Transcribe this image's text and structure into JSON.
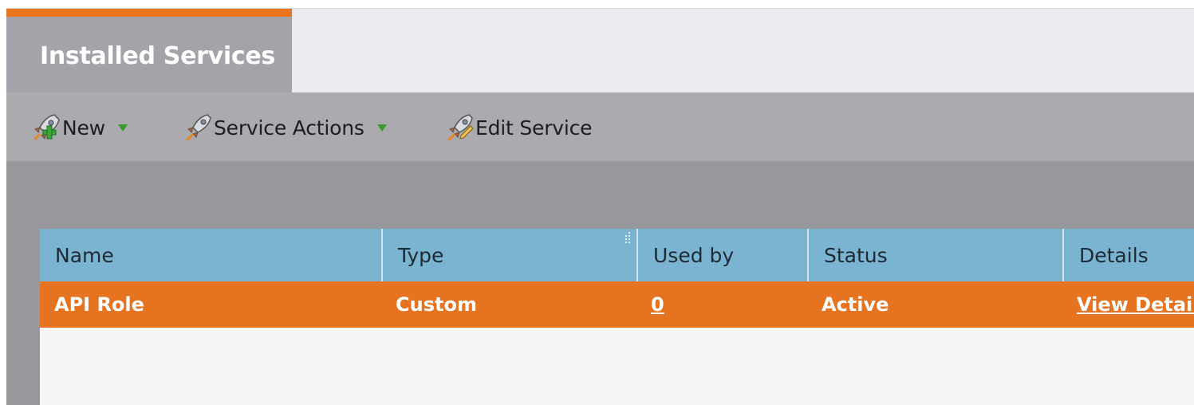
{
  "tabs": [
    {
      "label": "Installed Services",
      "active": true
    }
  ],
  "toolbar": {
    "new_label": "New",
    "service_actions_label": "Service Actions",
    "edit_service_label": "Edit Service"
  },
  "table": {
    "columns": [
      "Name",
      "Type",
      "Used by",
      "Status",
      "Details"
    ],
    "rows": [
      {
        "name": "API Role",
        "type": "Custom",
        "used_by": "0",
        "status": "Active",
        "details": "View Details"
      }
    ]
  },
  "colors": {
    "accent_orange": "#e57320",
    "header_blue": "#7ab4d1",
    "toolbar_gray": "#abaaaf"
  },
  "icons": [
    "rocket-add-icon",
    "rocket-icon",
    "rocket-edit-icon",
    "dropdown-caret-icon"
  ]
}
